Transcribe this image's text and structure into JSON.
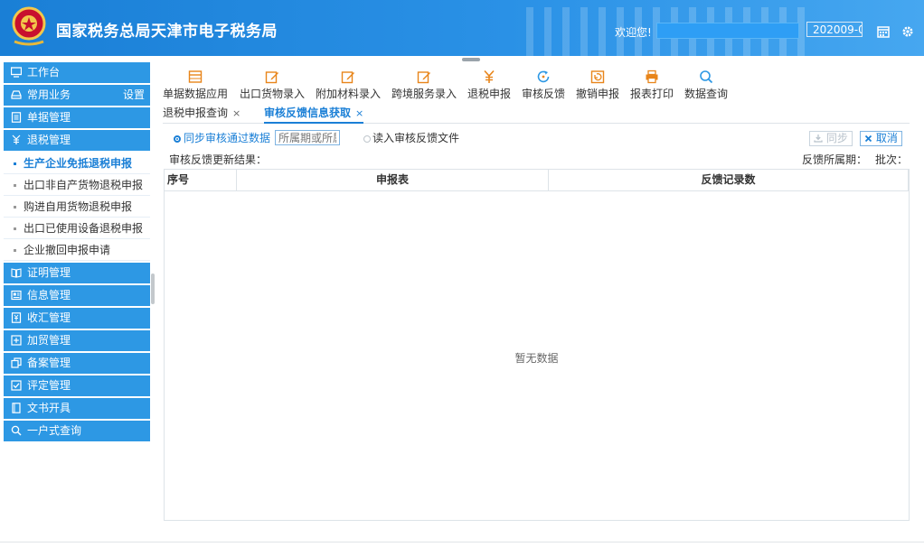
{
  "header": {
    "title": "国家税务总局天津市电子税务局",
    "welcome": "欢迎您!",
    "period": "202009-0"
  },
  "sidebar": {
    "items": [
      {
        "label": "工作台",
        "icon": "monitor-icon"
      },
      {
        "label": "常用业务",
        "icon": "inbox-icon",
        "extra": "设置"
      },
      {
        "label": "单据管理",
        "icon": "document-icon"
      },
      {
        "label": "退税管理",
        "icon": "tax-refund-icon"
      }
    ],
    "sub_items": [
      {
        "label": "生产企业免抵退税申报",
        "active": true
      },
      {
        "label": "出口非自产货物退税申报"
      },
      {
        "label": "购进自用货物退税申报"
      },
      {
        "label": "出口已使用设备退税申报"
      },
      {
        "label": "企业撤回申报申请"
      }
    ],
    "items_after": [
      {
        "label": "证明管理",
        "icon": "book-icon"
      },
      {
        "label": "信息管理",
        "icon": "news-icon"
      },
      {
        "label": "收汇管理",
        "icon": "currency-icon"
      },
      {
        "label": "加贸管理",
        "icon": "plus-box-icon"
      },
      {
        "label": "备案管理",
        "icon": "copy-icon"
      },
      {
        "label": "评定管理",
        "icon": "check-box-icon"
      },
      {
        "label": "文书开具",
        "icon": "file-icon"
      },
      {
        "label": "一户式查询",
        "icon": "search-icon"
      }
    ]
  },
  "toolbar": {
    "items": [
      {
        "label": "单据数据应用",
        "icon": "window-icon"
      },
      {
        "label": "出口货物录入",
        "icon": "edit-icon"
      },
      {
        "label": "附加材料录入",
        "icon": "edit-icon"
      },
      {
        "label": "跨境服务录入",
        "icon": "edit-icon"
      },
      {
        "label": "退税申报",
        "icon": "yen-icon"
      },
      {
        "label": "审核反馈",
        "icon": "refresh-icon"
      },
      {
        "label": "撤销申报",
        "icon": "undo-icon"
      },
      {
        "label": "报表打印",
        "icon": "printer-icon"
      },
      {
        "label": "数据查询",
        "icon": "magnifier-icon"
      }
    ]
  },
  "tabs": [
    {
      "label": "退税申报查询",
      "close": "×"
    },
    {
      "label": "审核反馈信息获取",
      "close": "×",
      "active": true
    }
  ],
  "options": {
    "sync_label": "同步审核通过数据",
    "period_placeholder": "所属期或所属",
    "read_label": "读入审核反馈文件",
    "sync_button": "同步",
    "cancel_button": "取消"
  },
  "result": {
    "label": "审核反馈更新结果：",
    "period_label": "反馈所属期：",
    "batch_label": "批次："
  },
  "grid": {
    "columns": [
      "序号",
      "申报表",
      "反馈记录数"
    ],
    "empty_text": "暂无数据"
  },
  "colors": {
    "header_blue": "#1a7fd6",
    "sidebar_blue": "#2d98e4",
    "accent": "#1a7fd6"
  }
}
